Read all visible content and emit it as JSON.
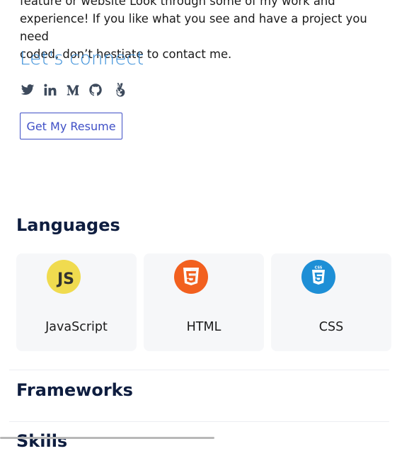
{
  "about": {
    "line1": "feature or website Look through some of my work and",
    "line2": "experience! If you like what you see and have a project you need",
    "line3": "coded, don’t hestiate to contact me."
  },
  "connect": {
    "title": "Let's connect",
    "socials": [
      "twitter-icon",
      "linkedin-icon",
      "medium-icon",
      "github-icon",
      "angellist-icon"
    ]
  },
  "resume": {
    "label": "Get My Resume"
  },
  "sections": {
    "languages": "Languages",
    "frameworks": "Frameworks",
    "skills_partial": "Skills"
  },
  "languages": [
    {
      "name": "JavaScript",
      "logo_text": "JS",
      "color": "#f0db4f"
    },
    {
      "name": "HTML",
      "logo_text": "5",
      "color": "#f2601f"
    },
    {
      "name": "CSS",
      "logo_text": "3",
      "color": "#1e8fd6"
    }
  ]
}
